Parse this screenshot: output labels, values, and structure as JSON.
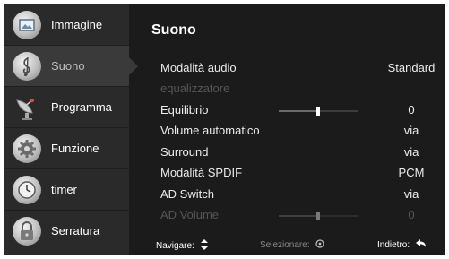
{
  "sidebar": {
    "items": [
      {
        "label": "Immagine",
        "icon": "picture-icon",
        "active": false
      },
      {
        "label": "Suono",
        "icon": "music-note-icon",
        "active": true
      },
      {
        "label": "Programma",
        "icon": "satellite-dish-icon",
        "active": false
      },
      {
        "label": "Funzione",
        "icon": "gear-icon",
        "active": false
      },
      {
        "label": "timer",
        "icon": "clock-icon",
        "active": false
      },
      {
        "label": "Serratura",
        "icon": "lock-icon",
        "active": false
      }
    ]
  },
  "main": {
    "title": "Suono",
    "settings": [
      {
        "label": "Modalità audio",
        "value": "Standard",
        "disabled": false
      },
      {
        "label": "equalizzatore",
        "value": "",
        "disabled": true
      },
      {
        "label": "Equilibrio",
        "value": "0",
        "disabled": false,
        "slider_level": 0.5
      },
      {
        "label": "Volume automatico",
        "value": "via",
        "disabled": false
      },
      {
        "label": "Surround",
        "value": "via",
        "disabled": false
      },
      {
        "label": "Modalità SPDIF",
        "value": "PCM",
        "disabled": false
      },
      {
        "label": "AD Switch",
        "value": "via",
        "disabled": false
      },
      {
        "label": "AD Volume",
        "value": "0",
        "disabled": true,
        "slider_level": 0.5
      }
    ]
  },
  "footer": {
    "navigate_label": "Navigare:",
    "select_label": "Selezionare:",
    "back_label": "Indietro:"
  },
  "colors": {
    "background": "#1b1b1b",
    "sidebar": "#2a2a2a",
    "sidebar_active": "#3a3a3a",
    "text": "#ececec",
    "disabled_text": "#555555"
  }
}
